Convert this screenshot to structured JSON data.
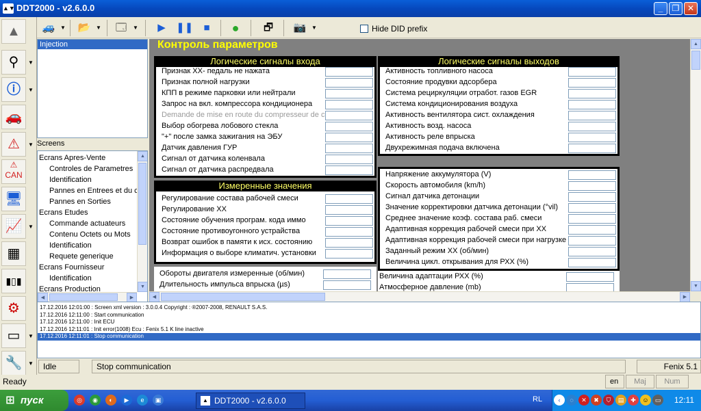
{
  "window": {
    "title": "DDT2000 - v2.6.0.0"
  },
  "toolbar": {
    "hide_did_label": "Hide DID prefix"
  },
  "left_panel": {
    "selected_item": "Injection",
    "screens_title": "Screens"
  },
  "tree": {
    "items": [
      {
        "label": "Ecrans Apres-Vente",
        "level": 0
      },
      {
        "label": "Controles de Parametres",
        "level": 1
      },
      {
        "label": "Identification",
        "level": 1
      },
      {
        "label": "Pannes en Entrees et du c",
        "level": 1
      },
      {
        "label": "Pannes en Sorties",
        "level": 1
      },
      {
        "label": "Ecrans Etudes",
        "level": 0
      },
      {
        "label": "Commande actuateurs",
        "level": 1
      },
      {
        "label": "Contenu Octets ou Mots",
        "level": 1
      },
      {
        "label": "Identification",
        "level": 1
      },
      {
        "label": "Requete generique",
        "level": 1
      },
      {
        "label": "Ecrans Fournisseur",
        "level": 0
      },
      {
        "label": "Identification",
        "level": 1
      },
      {
        "label": "Ecrans Production",
        "level": 0
      }
    ]
  },
  "main": {
    "title": "Контроль параметров",
    "input_signals": {
      "header": "Логические сигналы входа",
      "rows": [
        "Признак ХХ- педаль не нажата",
        "Признак полной нагрузки",
        "КПП в режиме парковки или нейтрали",
        "Запрос на вкл. компрессора кондиционера",
        "Demande de mise en route du compresseur de clim",
        "Выбор обогрева лобового стекла",
        "\"+\" после замка зажигания на ЭБУ",
        "Датчик давления ГУР",
        "Сигнал от датчика коленвала",
        "Сигнал от датчика распредвала"
      ]
    },
    "output_signals": {
      "header": "Логические сигналы выходов",
      "rows": [
        "Активность топливного насоса",
        "Состояние продувки адсорбера",
        "Система рециркуляции отработ. газов EGR",
        "Система кондиционирования воздуха",
        "Активность вентилятора сист. охлаждения",
        "Активность возд. насоса",
        "Активность реле впрыска",
        "Двухрежимная подача включена"
      ]
    },
    "measured": {
      "header": "Измеренные значения",
      "rows": [
        "Регулирование состава рабочей смеси",
        "Регулирование ХХ",
        "Состояние обучения програм. кода иммо",
        "Состояние противоугонного устрайства",
        "Возврат ошибок в памяти к исх. состоянию",
        "Информация о выборе климатич. установки"
      ]
    },
    "lower_left": {
      "rows": [
        "Обороты двигателя измеренные (об/мин)",
        "Длительность импульса впрыска (µs)"
      ]
    },
    "right_values": {
      "rows": [
        "Напряжение аккумулятора (V)",
        "Скорость автомобиля (km/h)",
        "Сигнал датчика детонации",
        "Значение корректировки датчика детонации (°vil)",
        "Среднее значение коэф. состава раб. смеси",
        "Адаптивная коррекция рабочей смеси при ХХ",
        "Адаптивная коррекция рабочей смеси при нагрузке",
        "Заданный режим ХХ (об/мин)",
        "Величина цикл. открывания для РХХ (%)"
      ]
    },
    "right_lower": {
      "rows": [
        "Величина адаптации РХХ (%)",
        "Атмосферное давление (mb)"
      ]
    }
  },
  "log": {
    "lines": [
      "17.12.2016 12:01:00 : Screen xml version : 3.0.0.4   Copyright : ®2007-2008, RENAULT S.A.S.",
      "17.12.2016 12:11:00 : Start communication",
      "17.12.2016 12:11:00 : Init ECU",
      "17.12.2016 12:11:01 : Init error(1008) Ecu : Fenix 5.1    K line inactive",
      "17.12.2016 12:11:01 : Stop communication"
    ]
  },
  "status": {
    "state": "Idle",
    "message": "Stop communication",
    "ecu": "Fenix 5.1",
    "ready": "Ready",
    "lang": "en",
    "maj": "Maj",
    "num": "Num"
  },
  "taskbar": {
    "start_label": "пуск",
    "task_label": "DDT2000 - v2.6.0.0",
    "lang": "RL",
    "clock": "12:11"
  }
}
